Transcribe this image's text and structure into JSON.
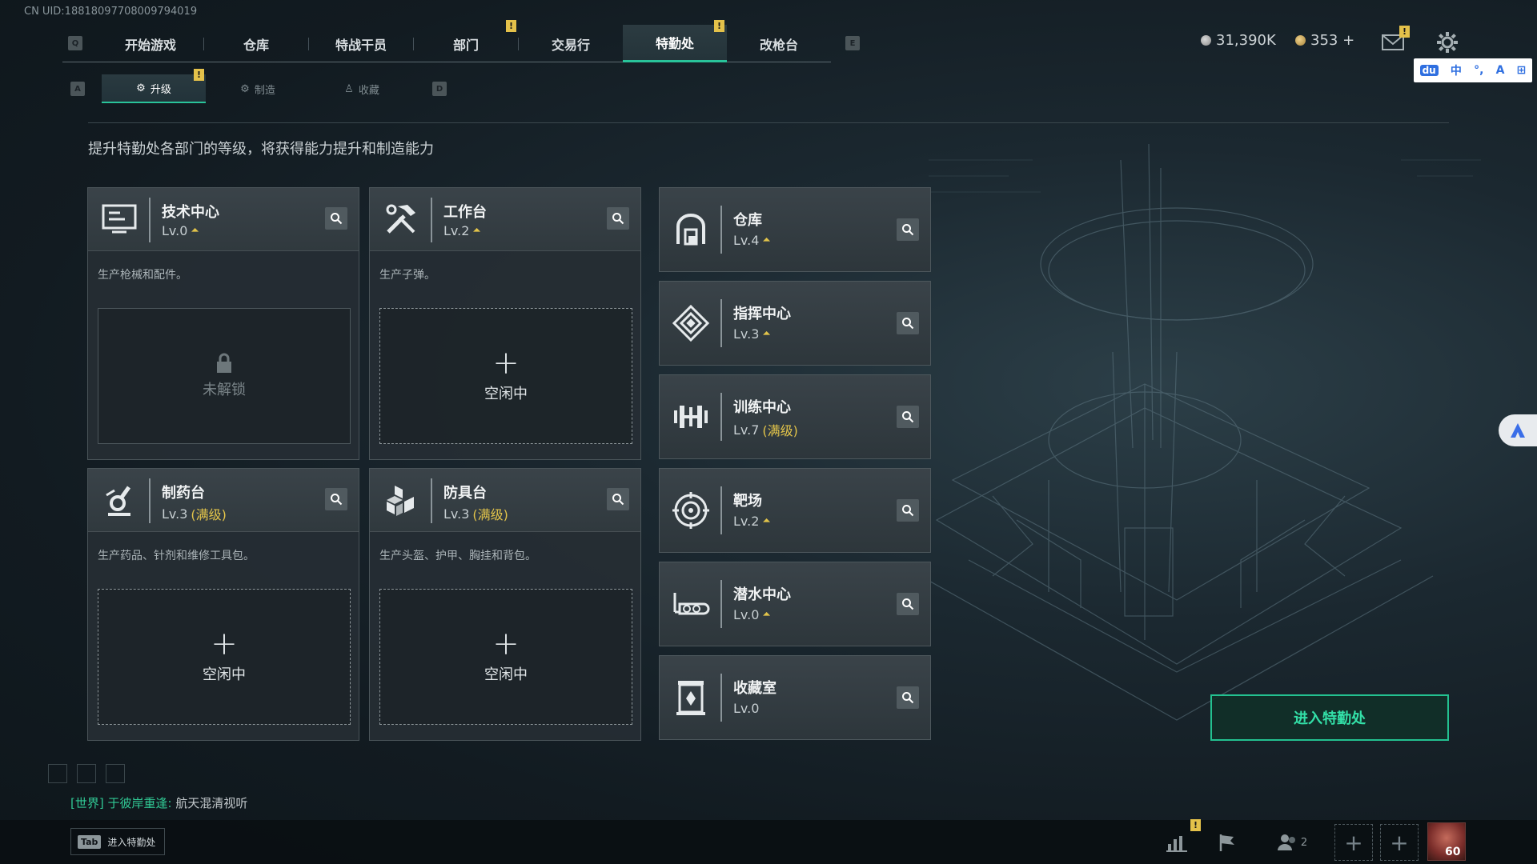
{
  "uid_text": "CN UID:18818097708009794019",
  "top_nav": {
    "left_key": "Q",
    "right_key": "E",
    "tabs": [
      {
        "label": "开始游戏"
      },
      {
        "label": "仓库"
      },
      {
        "label": "特战干员"
      },
      {
        "label": "部门"
      },
      {
        "label": "交易行"
      },
      {
        "label": "特勤处"
      },
      {
        "label": "改枪台"
      }
    ],
    "active_tab": "特勤处"
  },
  "currency": {
    "silver": "31,390K",
    "gold": "353 +"
  },
  "ime": {
    "items": [
      "du",
      "中",
      "°,",
      "A",
      "⊞"
    ]
  },
  "sub_tabs": {
    "left_key": "A",
    "right_key": "D",
    "tabs": [
      {
        "label": "升级"
      },
      {
        "label": "制造"
      },
      {
        "label": "收藏"
      }
    ]
  },
  "description": "提升特勤处各部门的等级，将获得能力提升和制造能力",
  "cards": [
    {
      "title": "技术中心",
      "level": "Lv.0",
      "level_note": "",
      "desc": "生产枪械和配件。",
      "slot_label": "未解锁",
      "icon": "tech-center-icon"
    },
    {
      "title": "工作台",
      "level": "Lv.2",
      "level_note": "",
      "desc": "生产子弹。",
      "slot_label": "空闲中",
      "icon": "workbench-icon"
    },
    {
      "title": "制药台",
      "level": "Lv.3",
      "level_note": "(满级)",
      "desc": "生产药品、针剂和维修工具包。",
      "slot_label": "空闲中",
      "icon": "pharmacy-icon"
    },
    {
      "title": "防具台",
      "level": "Lv.3",
      "level_note": "(满级)",
      "desc": "生产头盔、护甲、胸挂和背包。",
      "slot_label": "空闲中",
      "icon": "armor-bench-icon"
    }
  ],
  "right_cards": [
    {
      "title": "仓库",
      "level": "Lv.4",
      "level_note": "",
      "icon": "warehouse-icon"
    },
    {
      "title": "指挥中心",
      "level": "Lv.3",
      "level_note": "",
      "icon": "command-center-icon"
    },
    {
      "title": "训练中心",
      "level": "Lv.7",
      "level_note": "(满级)",
      "icon": "training-center-icon"
    },
    {
      "title": "靶场",
      "level": "Lv.2",
      "level_note": "",
      "icon": "shooting-range-icon"
    },
    {
      "title": "潜水中心",
      "level": "Lv.0",
      "level_note": "",
      "icon": "diving-center-icon"
    },
    {
      "title": "收藏室",
      "level": "Lv.0",
      "level_note": "",
      "icon": "collection-room-icon"
    }
  ],
  "enter_button": "进入特勤处",
  "chat": {
    "channel": "[世界]",
    "name": "于彼岸重逢:",
    "message": "航天混清视听"
  },
  "bottom": {
    "tab_key": "Tab",
    "tab_label": "进入特勤处",
    "friends_count": "2",
    "player_level": "60"
  },
  "colors": {
    "accent": "#29c39a",
    "warning": "#e4c14a",
    "maxed": "#e2c44a"
  }
}
